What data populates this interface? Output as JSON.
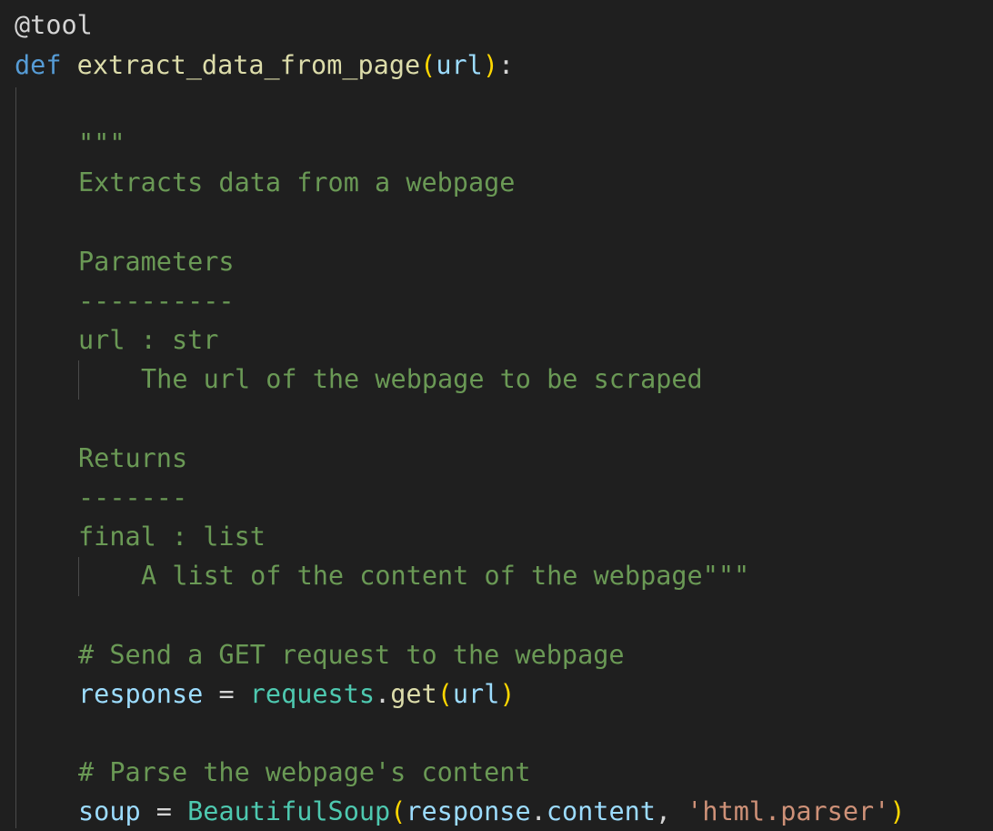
{
  "code": {
    "decorator": "@tool",
    "def_keyword": "def",
    "function_name": "extract_data_from_page",
    "open_paren": "(",
    "param": "url",
    "close_paren": ")",
    "colon": ":",
    "doc_open": "\"\"\"",
    "doc_summary": "Extracts data from a webpage",
    "doc_params_header": "Parameters",
    "doc_params_rule": "----------",
    "doc_param_sig": "url : str",
    "doc_param_desc": "The url of the webpage to be scraped",
    "doc_returns_header": "Returns",
    "doc_returns_rule": "-------",
    "doc_return_sig": "final : list",
    "doc_return_desc": "A list of the content of the webpage\"\"\"",
    "comment_get": "# Send a GET request to the webpage",
    "resp_var": "response",
    "assign": " = ",
    "requests_mod": "requests",
    "dot": ".",
    "get_fn": "get",
    "get_arg": "url",
    "comment_parse": "# Parse the webpage's content",
    "soup_var": "soup",
    "bs_class": "BeautifulSoup",
    "bs_arg_obj": "response",
    "bs_arg_attr": "content",
    "comma": ", ",
    "parser_str": "'html.parser'"
  }
}
